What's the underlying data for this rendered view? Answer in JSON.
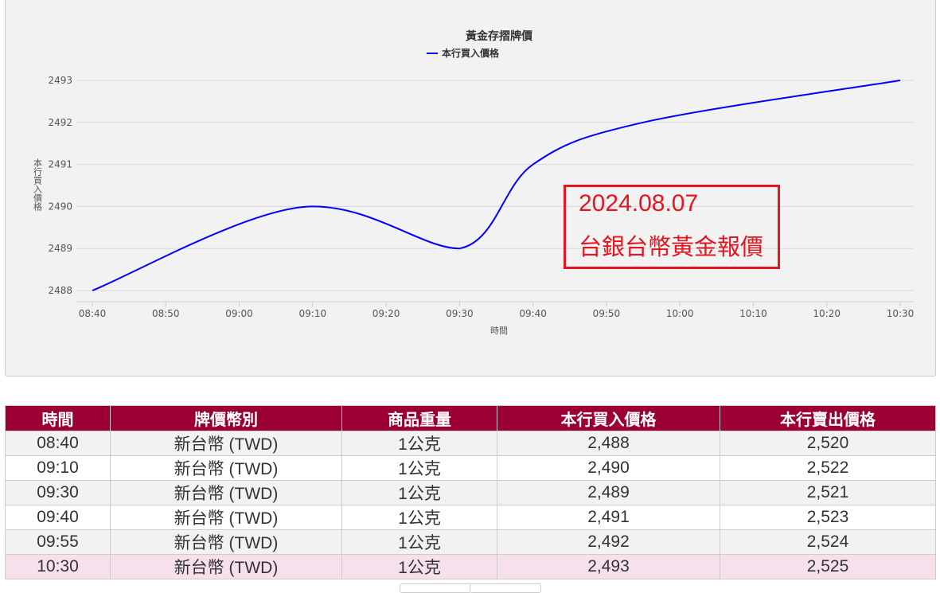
{
  "chart_data": {
    "type": "line",
    "title": "黃金存摺牌價",
    "legend": [
      "本行買入價格"
    ],
    "legend_placement": "top-center",
    "xlabel": "時間",
    "ylabel": "本行買入價格",
    "x_ticks": [
      "08:40",
      "08:50",
      "09:00",
      "09:10",
      "09:20",
      "09:30",
      "09:40",
      "09:50",
      "10:00",
      "10:10",
      "10:20",
      "10:30"
    ],
    "y_ticks": [
      2488,
      2489,
      2490,
      2491,
      2492,
      2493
    ],
    "ylim": [
      2488,
      2493
    ],
    "series": [
      {
        "name": "本行買入價格",
        "color": "#0000ff",
        "x": [
          "08:40",
          "09:10",
          "09:30",
          "09:40",
          "09:55",
          "10:30"
        ],
        "values": [
          2488,
          2490,
          2489,
          2491,
          2492,
          2493
        ]
      }
    ]
  },
  "annotation": {
    "date": "2024.08.07",
    "text": "台銀台幣黃金報價",
    "color": "#e3151f"
  },
  "table": {
    "headers": [
      "時間",
      "牌價幣別",
      "商品重量",
      "本行買入價格",
      "本行賣出價格"
    ],
    "rows": [
      [
        "08:40",
        "新台幣 (TWD)",
        "1公克",
        "2,488",
        "2,520"
      ],
      [
        "09:10",
        "新台幣 (TWD)",
        "1公克",
        "2,490",
        "2,522"
      ],
      [
        "09:30",
        "新台幣 (TWD)",
        "1公克",
        "2,489",
        "2,521"
      ],
      [
        "09:40",
        "新台幣 (TWD)",
        "1公克",
        "2,491",
        "2,523"
      ],
      [
        "09:55",
        "新台幣 (TWD)",
        "1公克",
        "2,492",
        "2,524"
      ],
      [
        "10:30",
        "新台幣 (TWD)",
        "1公克",
        "2,493",
        "2,525"
      ]
    ]
  }
}
